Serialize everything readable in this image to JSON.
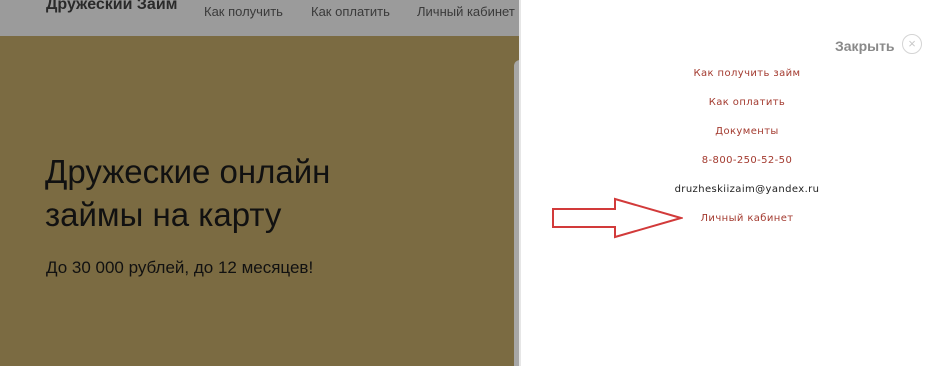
{
  "background_page": {
    "brand": "Дружеский Займ",
    "nav": [
      "Как получить",
      "Как оплатить",
      "Личный кабинет"
    ],
    "hero_title_line1": "Дружеские онлайн",
    "hero_title_line2": "займы на карту",
    "hero_subtitle": "До 30 000 рублей, до 12 месяцев!"
  },
  "menu_panel": {
    "close_label": "Закрыть",
    "close_icon": "×",
    "items": [
      {
        "label": "Как получить займ",
        "type": "link"
      },
      {
        "label": "Как оплатить",
        "type": "link"
      },
      {
        "label": "Документы",
        "type": "link"
      },
      {
        "label": "8-800-250-52-50",
        "type": "link"
      },
      {
        "label": "druzheskiizaim@yandex.ru",
        "type": "text"
      },
      {
        "label": "Личный кабинет",
        "type": "link"
      }
    ]
  },
  "annotation": {
    "shape": "arrow-right-outline",
    "color": "#d23a3a"
  },
  "colors": {
    "overlay_page": "#7b6b42",
    "menu_link": "#a33a2f",
    "close_text": "#8a8a8a"
  }
}
